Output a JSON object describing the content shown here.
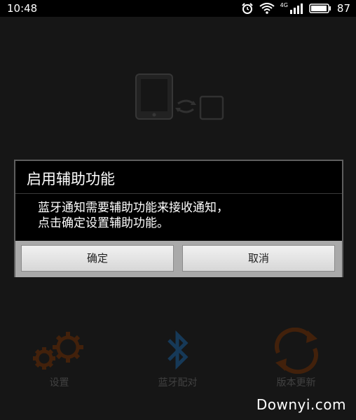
{
  "status_bar": {
    "time": "10:48",
    "signal_label": "4G",
    "battery_level": "87"
  },
  "dialog": {
    "title": "启用辅助功能",
    "message_line1": "蓝牙通知需要辅助功能来接收通知，",
    "message_line2": "点击确定设置辅助功能。",
    "confirm_label": "确定",
    "cancel_label": "取消"
  },
  "menu": {
    "items": [
      {
        "label": "设置",
        "icon": "gears-icon"
      },
      {
        "label": "蓝牙配对",
        "icon": "bluetooth-icon"
      },
      {
        "label": "版本更新",
        "icon": "refresh-icon"
      }
    ]
  },
  "watermark": "Downyi.com",
  "colors": {
    "accent_orange": "#6a3410",
    "bluetooth_blue": "#1f4f7a"
  }
}
